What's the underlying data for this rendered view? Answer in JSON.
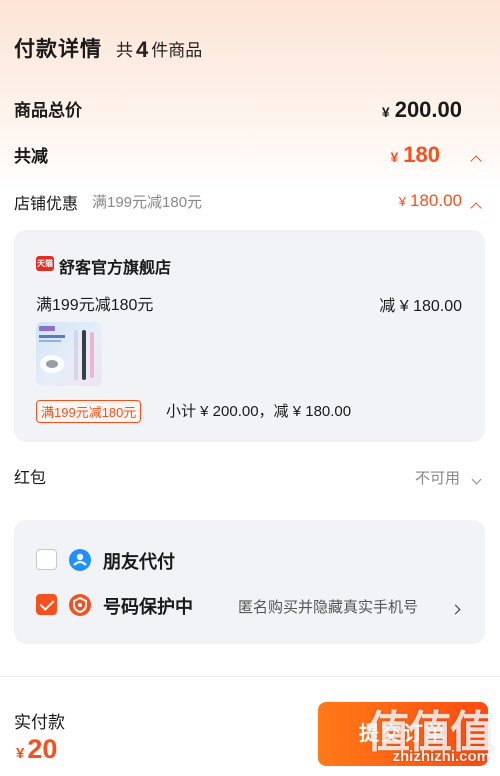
{
  "header": {
    "title": "付款详情",
    "count_prefix": "共",
    "count": "4",
    "count_suffix": "件商品"
  },
  "summary": {
    "total_label": "商品总价",
    "total_currency": "¥",
    "total_value": "200.00",
    "discount_label": "共减",
    "discount_currency": "¥",
    "discount_value": "180"
  },
  "store_discount": {
    "label": "店铺优惠",
    "desc": "满199元减180元",
    "currency": "¥",
    "value": "180.00"
  },
  "store_card": {
    "logo_text": "天猫",
    "store_name": "舒客官方旗舰店",
    "rule": "满199元减180元",
    "rule_off_prefix": "减 ¥",
    "rule_off_value": "180.00",
    "promo_tag": "满199元减180元",
    "subtotal_text": "小计 ¥ 200.00，减 ¥ 180.00"
  },
  "red_packet": {
    "label": "红包",
    "status": "不可用"
  },
  "options": {
    "friend_pay_label": "朋友代付",
    "number_protect_label": "号码保护中",
    "number_protect_desc": "匿名购买并隐藏真实手机号"
  },
  "footer": {
    "paid_label": "实付款",
    "paid_currency": "¥",
    "paid_value": "20",
    "submit_label": "提交订单"
  },
  "watermark": {
    "text": "值值值",
    "url": "zhizhizhi.com"
  },
  "colors": {
    "accent": "#f4511e",
    "card_bg": "#f1f3f6",
    "header_bg": "#fde4d6"
  }
}
